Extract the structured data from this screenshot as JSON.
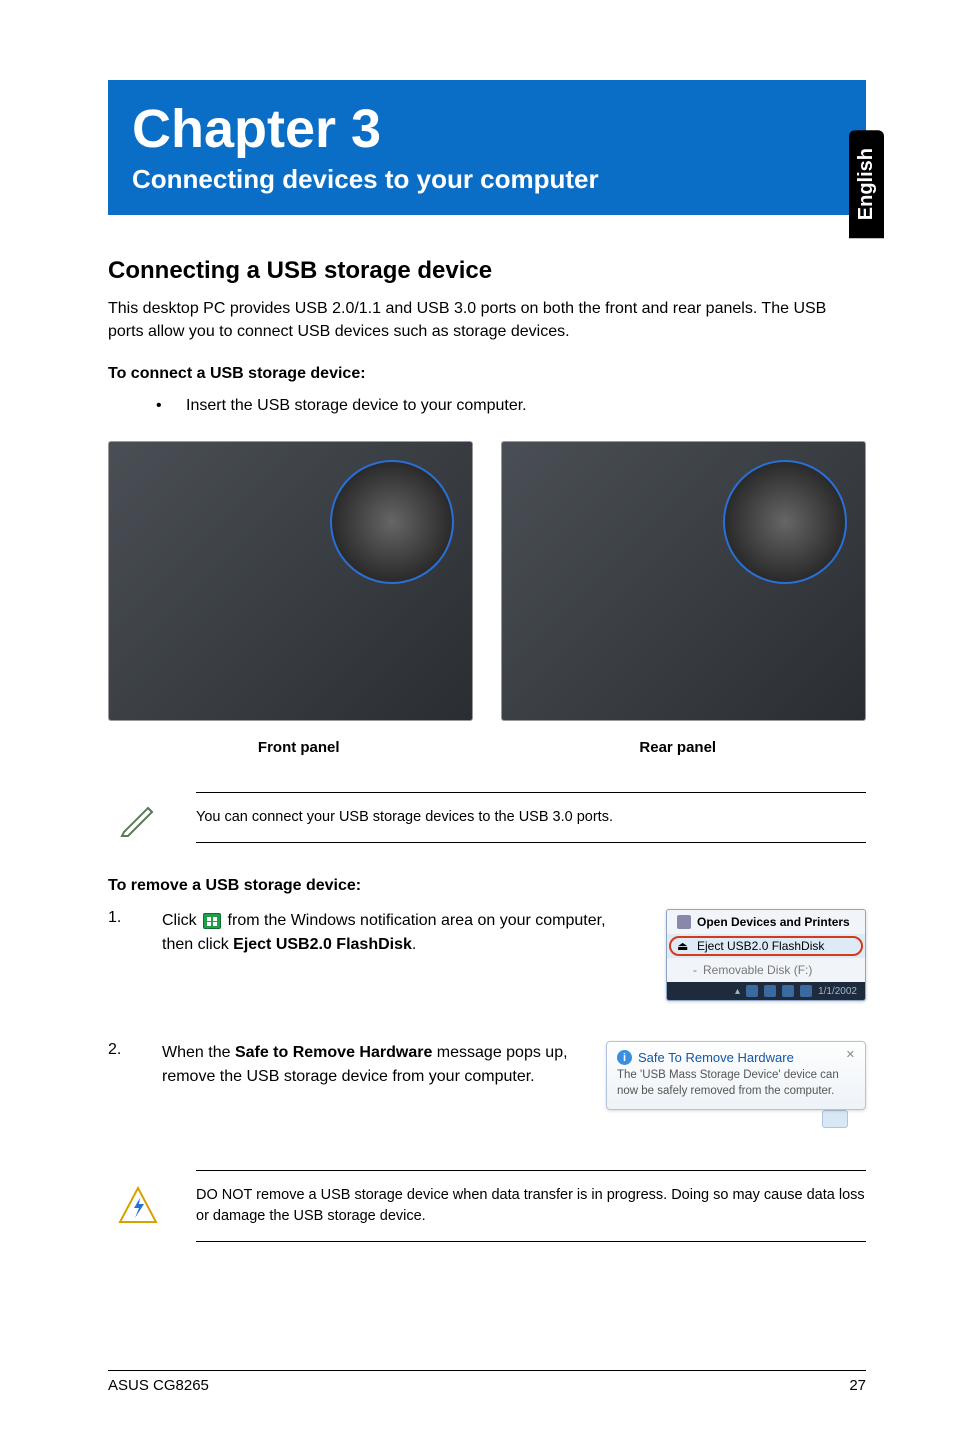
{
  "sideTab": "English",
  "chapter": {
    "title": "Chapter 3",
    "subtitle": "Connecting devices to your computer"
  },
  "section1": {
    "heading": "Connecting a USB storage device",
    "intro": "This desktop PC provides USB 2.0/1.1 and USB 3.0 ports on both the front and rear panels. The USB ports allow you to connect USB devices such as storage devices.",
    "connectLabel": "To connect a USB storage device:",
    "connectBullet": "Insert the USB storage device to your computer.",
    "frontLabel": "Front panel",
    "rearLabel": "Rear panel",
    "note1": "You can connect your USB storage devices to the USB 3.0 ports.",
    "removeLabel": "To remove a USB storage device:",
    "step1_num": "1.",
    "step1_a": "Click ",
    "step1_b": " from the Windows notification area on your computer, then click ",
    "step1_bold": "Eject USB2.0 FlashDisk",
    "step1_c": ".",
    "step2_num": "2.",
    "step2_a": "When the ",
    "step2_bold": "Safe to Remove Hardware",
    "step2_b": " message pops up, remove the USB storage device from your computer.",
    "warning": "DO NOT remove a USB storage device when data transfer is in progress. Doing so may cause data loss or damage the USB storage device."
  },
  "popup1": {
    "row1": "Open Devices and Printers",
    "row2": "Eject USB2.0 FlashDisk",
    "row3": "Removable Disk (F:)",
    "trayDate": "1/1/2002"
  },
  "balloon": {
    "title": "Safe To Remove Hardware",
    "body": "The 'USB Mass Storage Device' device can now be safely removed from the computer."
  },
  "footer": {
    "left": "ASUS CG8265",
    "right": "27"
  }
}
